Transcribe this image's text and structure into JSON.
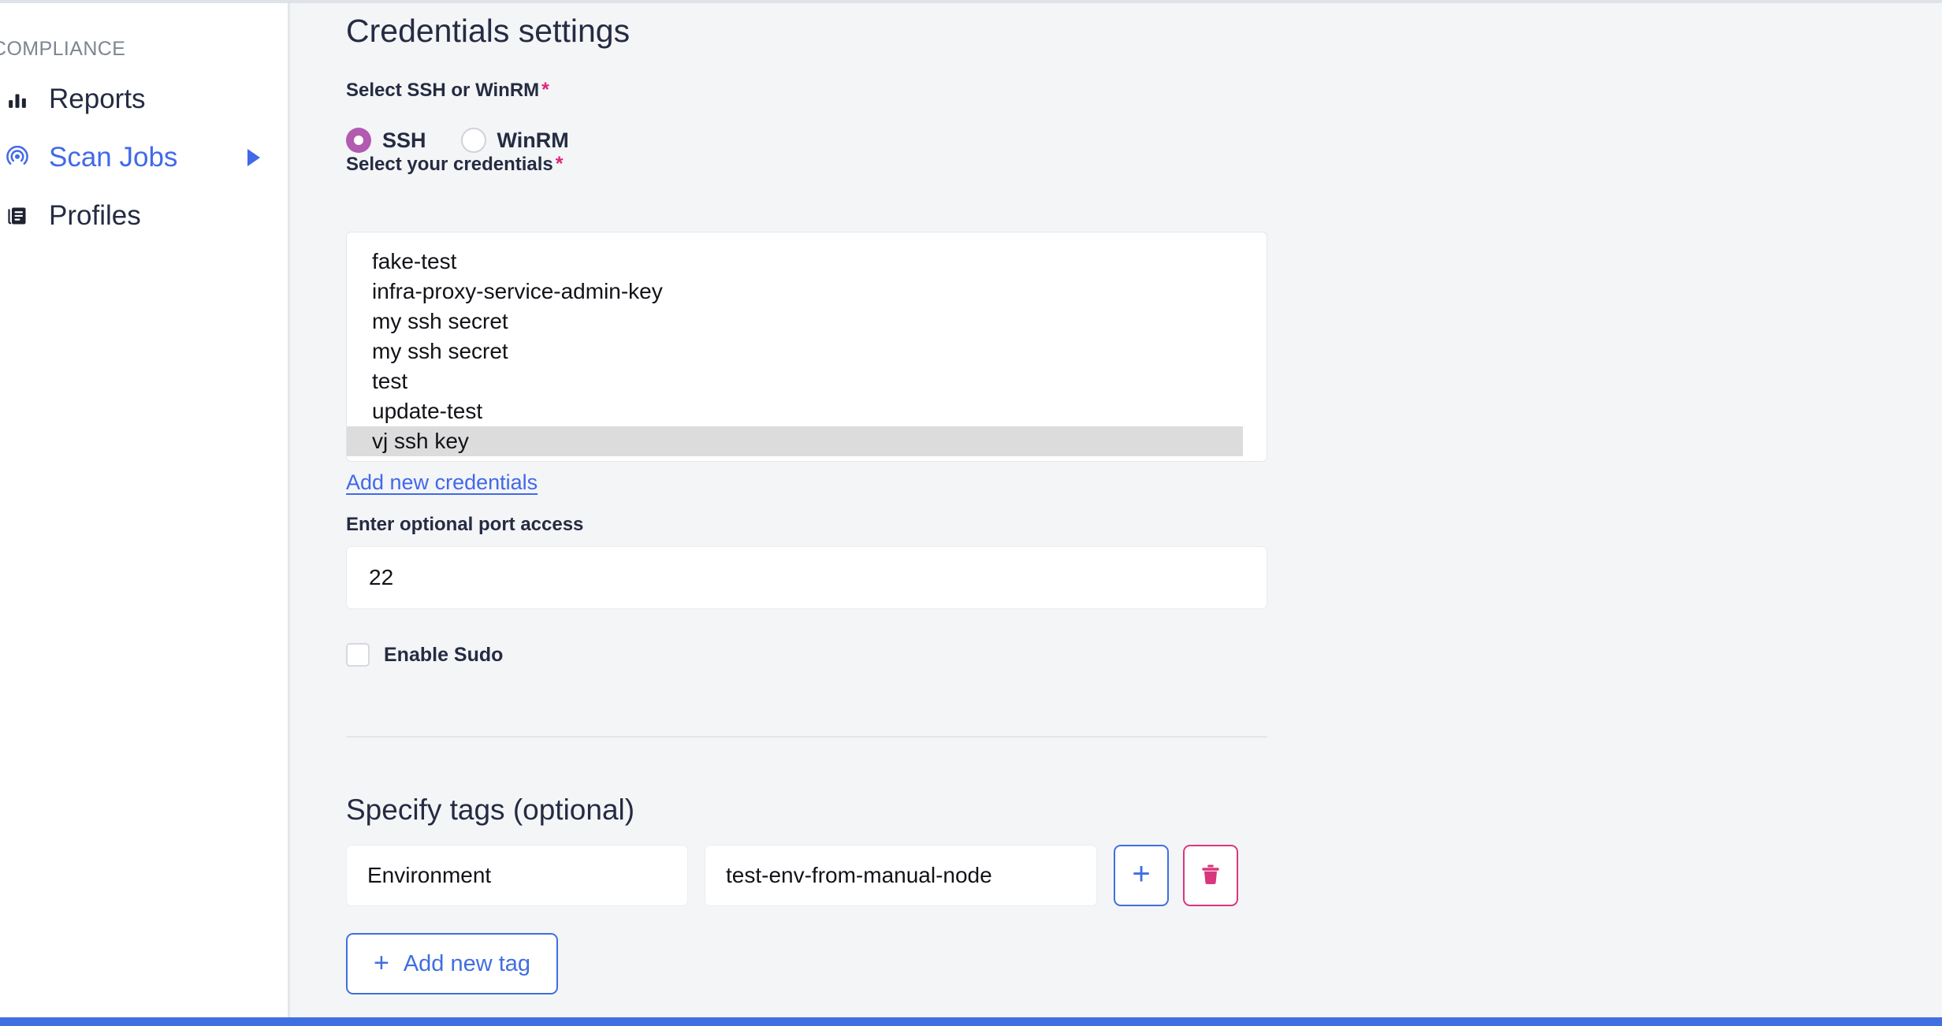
{
  "sidebar": {
    "section_label": "COMPLIANCE",
    "items": [
      {
        "label": "Reports",
        "icon": "bar-chart-icon",
        "active": false,
        "has_arrow": false
      },
      {
        "label": "Scan Jobs",
        "icon": "radar-scan-icon",
        "active": true,
        "has_arrow": true
      },
      {
        "label": "Profiles",
        "icon": "documents-icon",
        "active": false,
        "has_arrow": false
      }
    ]
  },
  "main": {
    "page_title": "Credentials settings",
    "protocol": {
      "label": "Select SSH or WinRM",
      "required_marker": "*",
      "options": [
        {
          "label": "SSH",
          "selected": true
        },
        {
          "label": "WinRM",
          "selected": false
        }
      ]
    },
    "credentials": {
      "label": "Select your credentials",
      "required_marker": "*",
      "options": [
        "fake-test",
        "infra-proxy-service-admin-key",
        "my ssh secret",
        "my ssh secret",
        "test",
        "update-test",
        "vj ssh key"
      ],
      "selected": "vj ssh key",
      "add_link": "Add new credentials"
    },
    "port": {
      "label": "Enter optional port access",
      "value": "22"
    },
    "sudo": {
      "label": "Enable Sudo",
      "checked": false
    },
    "tags": {
      "section_title": "Specify tags (optional)",
      "rows": [
        {
          "key": "Environment",
          "value": "test-env-from-manual-node"
        }
      ],
      "add_icon": "plus-icon",
      "delete_icon": "trash-icon",
      "add_button_label": "Add new tag",
      "add_button_icon": "plus-icon"
    }
  },
  "colors": {
    "accent_blue": "#3f6fe0",
    "link_blue": "#4169e8",
    "danger_pink": "#d8377e",
    "radio_purple": "#b25bb0",
    "required_star": "#e0247c",
    "page_bg": "#f4f5f7"
  }
}
